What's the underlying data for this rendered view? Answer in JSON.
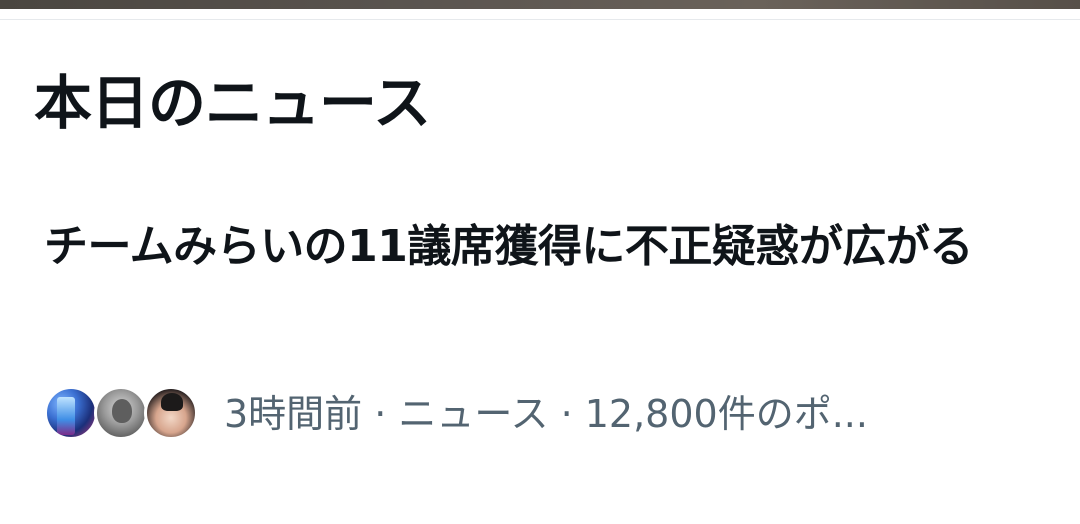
{
  "section": {
    "title": "本日のニュース"
  },
  "news": {
    "headline": "チームみらいの11議席獲得に不正疑惑が広がる",
    "meta": "3時間前 · ニュース · 12,800件のポ...",
    "avatars": [
      {
        "name": "avatar-1"
      },
      {
        "name": "avatar-2"
      },
      {
        "name": "avatar-3"
      }
    ]
  },
  "colors": {
    "text_primary": "#0f1419",
    "text_secondary": "#536471",
    "divider": "#e6e9ec",
    "background": "#ffffff"
  }
}
